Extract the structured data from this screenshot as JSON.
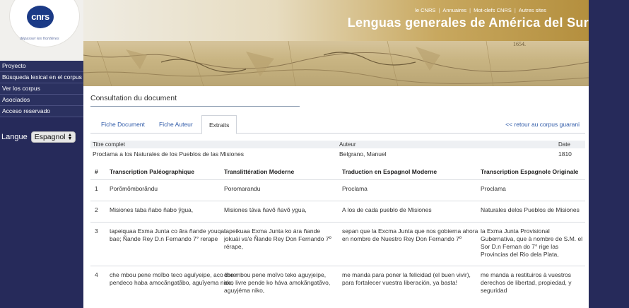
{
  "logo": {
    "mark": "cnrs",
    "tagline": "dépasser les frontières"
  },
  "nav": {
    "items": [
      {
        "label": "Proyecto"
      },
      {
        "label": "Búsqueda lexical en el corpus"
      },
      {
        "label": "Ver los corpus"
      },
      {
        "label": "Asociados"
      },
      {
        "label": "Acceso reservado"
      }
    ],
    "language_label": "Langue",
    "language_value": "Espagnol"
  },
  "header": {
    "links": [
      "le CNRS",
      "Annuaires",
      "Mot-clefs CNRS",
      "Autres sites"
    ],
    "title": "Lenguas generales de América del Sur",
    "map_number": "1654."
  },
  "document": {
    "heading": "Consultation du document",
    "tabs": [
      "Fiche Document",
      "Fiche Auteur",
      "Extraits"
    ],
    "active_tab": "Extraits",
    "back_link": "<< retour au corpus guarani",
    "meta_headers": {
      "title": "Titre complet",
      "author": "Auteur",
      "date": "Date"
    },
    "meta_values": {
      "title": "Proclama a los Naturales de los Pueblos de las Misiones",
      "author": "Belgrano, Manuel",
      "date": "1810"
    },
    "columns": [
      "#",
      "Transcription Paléographique",
      "Translittération Moderne",
      "Traduction en Espagnol Moderne",
      "Transcription Espagnole Originale"
    ],
    "rows": [
      {
        "n": "1",
        "a": "Porõmõmborãndu",
        "b": "Poromarandu",
        "c": "Proclama",
        "d": "Proclama"
      },
      {
        "n": "2",
        "a": "Misiones taba ñabo ñabo ỹgua,",
        "b": "Misiones táva ñavõ ñavõ ygua,",
        "c": "A los de cada pueblo de Misiones",
        "d": "Naturales delos Pueblos de Misiones"
      },
      {
        "n": "3",
        "a": "tapeiquaa Exma Junta co ãra ñande youqai bae; Ñande Rey D.n Fernando 7° rerape",
        "b": "tapeikuaa Exma Junta ko ára ñande jokuái va'e Ñande Rey Don Fernando 7º rérape,",
        "c": "sepan que la Excma Junta que nos gobierna ahora en nombre de Nuestro Rey Don Fernando 7º",
        "d": "la Exma Junta Provisional Gubernativa, que à nombre de S.M. el Sor D.n Fernan do 7° rige las Provincias del Rio dela Plata,"
      },
      {
        "n": "4",
        "a": "che mbou pene moĩbo teco aguîyeipe, aco libre pendeco haba amocãngatãbo, aguîyema nico,",
        "b": "che mbou pene moĩvo teko aguyjeípe, ako livre pende ko háva amokãngatãvo, aguyjéma niko,",
        "c": "me manda para poner la felicidad (el buen vivir), para fortalecer vuestra liberación, ya basta!",
        "d": "me manda a restituiros à vuestros derechos de libertad, propiedad, y seguridad"
      }
    ]
  }
}
